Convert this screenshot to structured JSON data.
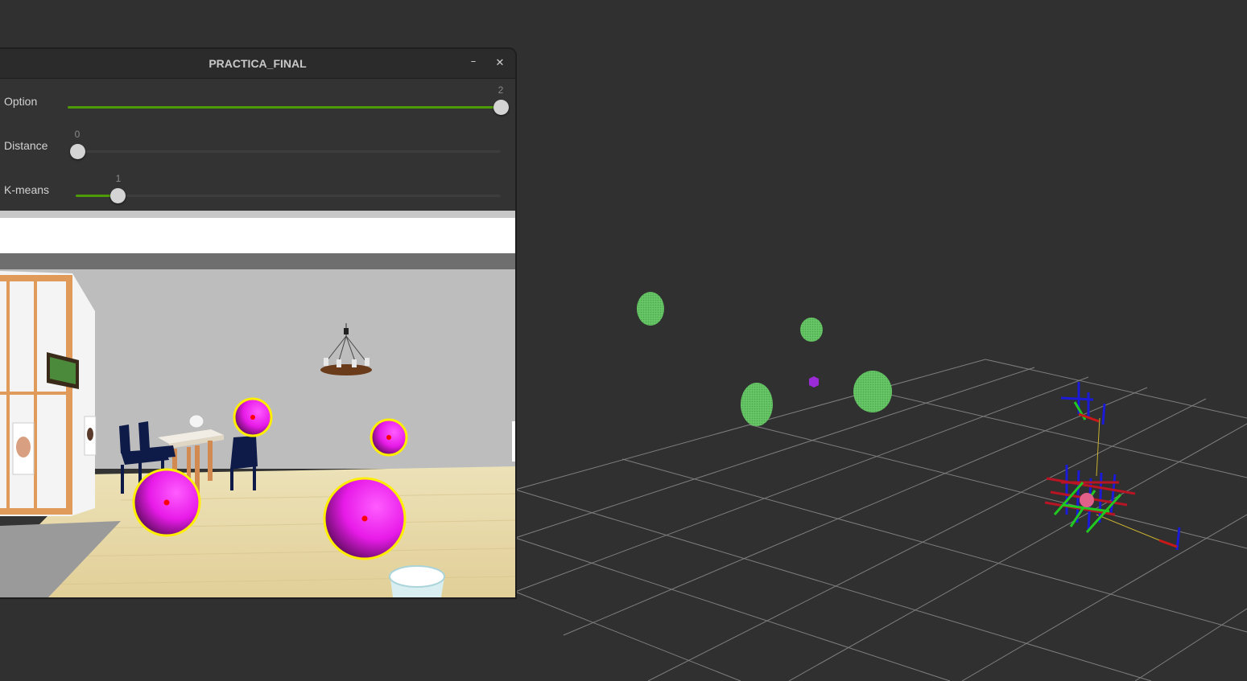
{
  "window": {
    "title": "PRACTICA_FINAL",
    "minimize_glyph": "–",
    "close_glyph": "✕"
  },
  "trackbars": [
    {
      "label": "Option",
      "value": "2",
      "fraction": 1.0
    },
    {
      "label": "Distance",
      "value": "0",
      "fraction": 0.0
    },
    {
      "label": "K-means",
      "value": "1",
      "fraction": 0.1
    }
  ],
  "colors": {
    "background": "#303030",
    "grid": "#8a8a8a",
    "trackbar_fill": "#4e9a06",
    "sphere_magenta": "#e81be8",
    "circle_outline": "#ffee00",
    "center_dot": "#ff0000",
    "pointcloud_green": "#6dcc6d",
    "marker_purple": "#9a2bd6"
  },
  "scene": {
    "detected_spheres": 4,
    "pointcloud_clusters": 4
  }
}
